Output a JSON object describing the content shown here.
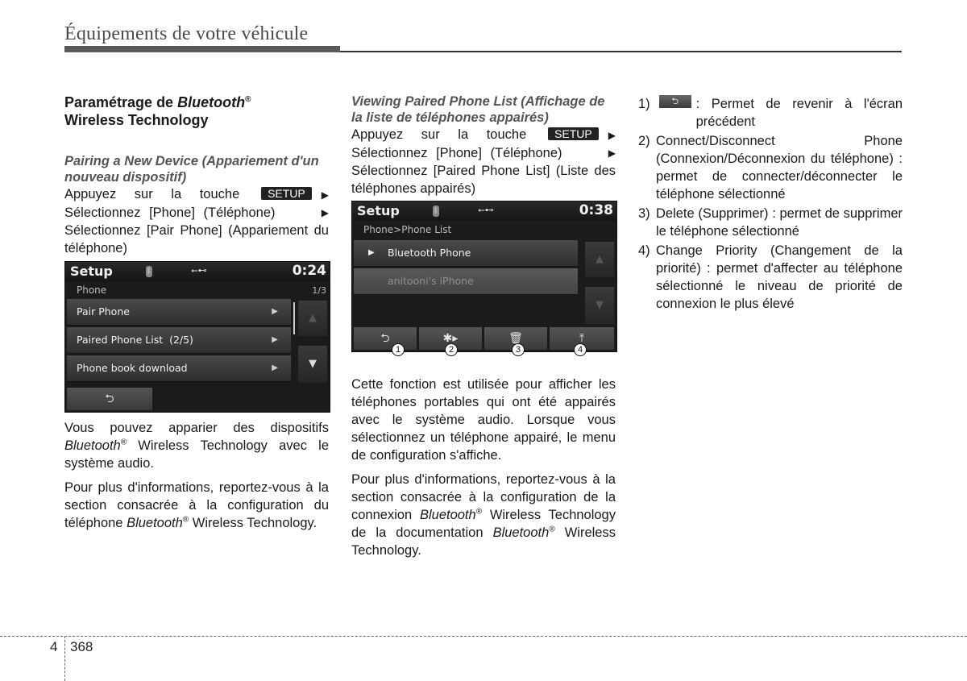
{
  "header": {
    "title": "Équipements de votre véhicule"
  },
  "column1": {
    "heading_prefix": "Paramétrage de ",
    "heading_italic": "Bluetooth",
    "heading_sup": "®",
    "heading_line2": "Wireless Technology",
    "subheading": "Pairing a New Device (Appariement d'un nouveau dispositif)",
    "step1_text": "Appuyez sur la touche",
    "setup_key": "SETUP",
    "step2_text": "Sélectionnez [Phone] (Téléphone)",
    "step3_text": "Sélectionnez [Pair Phone] (Appariement du téléphone)",
    "arrow": "▶",
    "screen": {
      "title": "Setup",
      "time": "0:24",
      "bt_icon": "bluetooth-icon",
      "usb_icon": "usb-icon",
      "subtitle": "Phone",
      "page": "1/3",
      "items": [
        {
          "label": "Pair Phone"
        },
        {
          "label": "Paired Phone List  (2/5)"
        },
        {
          "label": "Phone book download"
        }
      ],
      "item_arrow": "▶",
      "scroll_up": "▲",
      "scroll_down": "▼",
      "back_glyph": "⮌"
    },
    "para1_a": "Vous pouvez apparier des dispositifs",
    "para1_italic": "Bluetooth",
    "para1_b": " Wireless Technology avec le système audio.",
    "para2_a": "Pour plus d'informations, reportez-vous à la section consacrée à la configuration du téléphone ",
    "para2_italic": "Bluetooth",
    "para2_b": " Wireless Technology."
  },
  "column2": {
    "subheading": "Viewing Paired Phone List (Affichage de la liste de téléphones appairés)",
    "step1_text": "Appuyez sur la touche",
    "setup_key": "SETUP",
    "step2_text": "Sélectionnez [Phone] (Téléphone)",
    "step3_text": "Sélectionnez [Paired Phone List] (Liste des téléphones appairés)",
    "arrow": "▶",
    "screen": {
      "title": "Setup",
      "time": "0:38",
      "subtitle": "Phone>Phone List",
      "items": [
        {
          "label": "Bluetooth Phone",
          "marker": "▶"
        },
        {
          "label": "anitooni's iPhone"
        }
      ],
      "scroll_up": "▲",
      "scroll_down": "▼",
      "buttons": [
        {
          "icon": "back-icon",
          "glyph": "⮌"
        },
        {
          "icon": "bluetooth-connect-icon",
          "glyph": "✱▸"
        },
        {
          "icon": "trash-icon",
          "glyph": "🗑"
        },
        {
          "icon": "priority-icon",
          "glyph": "⤒"
        }
      ],
      "callouts": [
        "1",
        "2",
        "3",
        "4"
      ]
    },
    "para1": "Cette fonction est utilisée pour afficher les téléphones portables qui ont été appairés avec le système audio. Lorsque vous sélectionnez un téléphone appairé, le menu de configuration s'affiche.",
    "para2_a": "Pour plus d'informations, reportez-vous à la section consacrée à la configuration de la connexion ",
    "para2_italic1": "Bluetooth",
    "para2_b": " Wireless Technology de la documentation ",
    "para2_italic2": "Bluetooth",
    "para2_c": " Wireless Technology."
  },
  "column3": {
    "items": [
      {
        "num": "1)",
        "text": ": Permet de revenir à l'écran précédent"
      },
      {
        "num": "2)",
        "text": "Connect/Disconnect Phone (Connexion/Déconnexion du téléphone) : permet de connecter/déconnecter le téléphone sélectionné"
      },
      {
        "num": "3)",
        "text": "Delete (Supprimer) : permet de supprimer le téléphone sélectionné"
      },
      {
        "num": "4)",
        "text": "Change Priority (Changement de la priorité) : permet d'affecter au téléphone sélectionné le niveau de priorité de connexion le plus élevé"
      }
    ],
    "back_glyph": "⮌"
  },
  "footer": {
    "chapter": "4",
    "page": "368"
  },
  "sup": "®"
}
